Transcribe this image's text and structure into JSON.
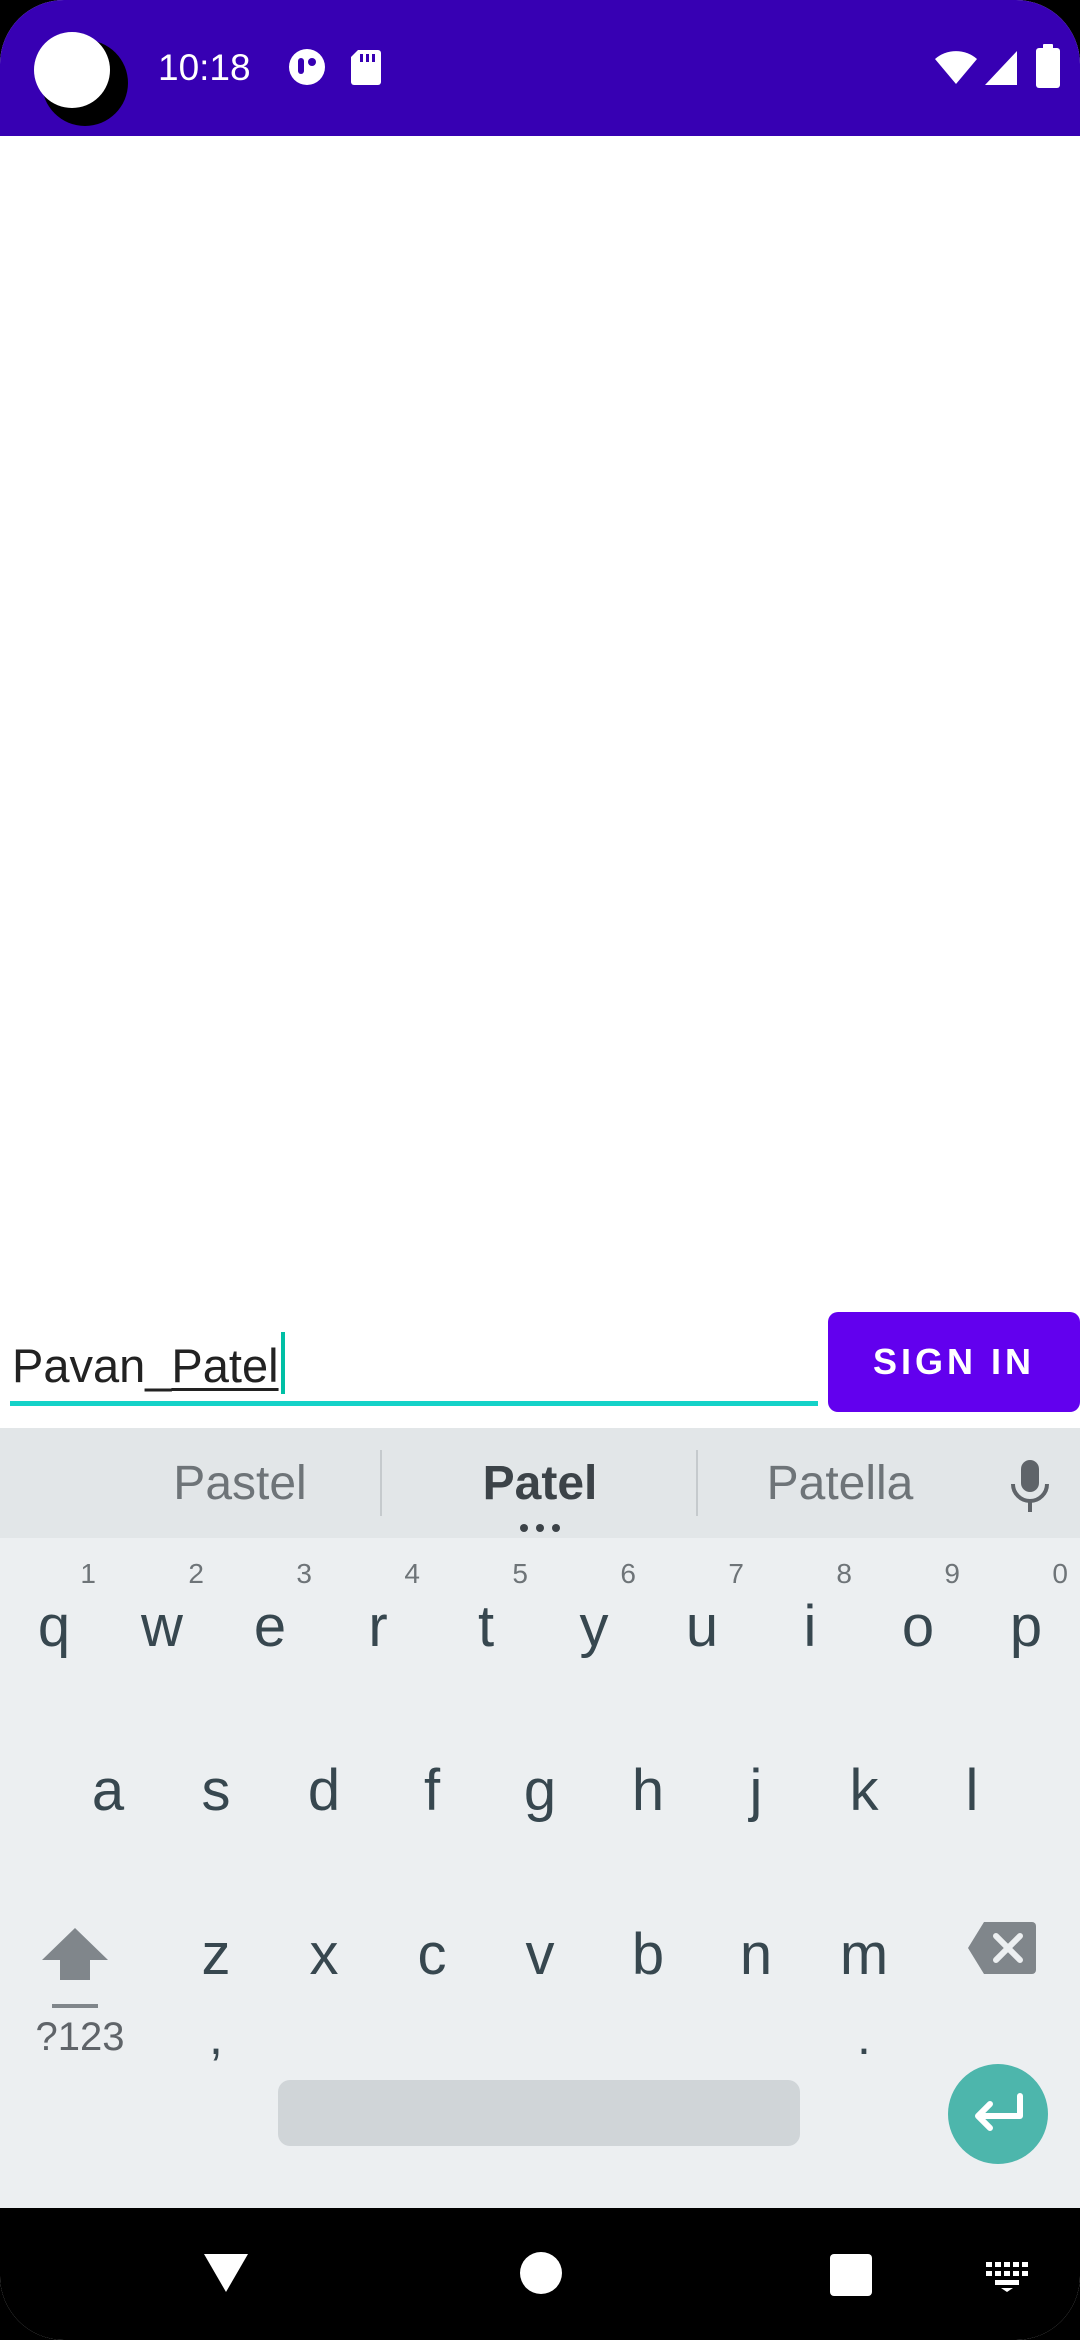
{
  "status_bar": {
    "time": "10:18",
    "icons": [
      "privacy-indicator-icon",
      "sd-card-icon",
      "wifi-icon",
      "signal-icon",
      "battery-icon"
    ],
    "background_color": "#3700b3"
  },
  "login": {
    "username_prefix": "Pavan_",
    "username_composing": "Patel",
    "sign_in_label": "SIGN IN",
    "accent_color": "#6200ee",
    "field_underline_color": "#14d2c8"
  },
  "keyboard": {
    "suggestions": [
      "Pastel",
      "Patel",
      "Patella"
    ],
    "row1": [
      {
        "key": "q",
        "hint": "1"
      },
      {
        "key": "w",
        "hint": "2"
      },
      {
        "key": "e",
        "hint": "3"
      },
      {
        "key": "r",
        "hint": "4"
      },
      {
        "key": "t",
        "hint": "5"
      },
      {
        "key": "y",
        "hint": "6"
      },
      {
        "key": "u",
        "hint": "7"
      },
      {
        "key": "i",
        "hint": "8"
      },
      {
        "key": "o",
        "hint": "9"
      },
      {
        "key": "p",
        "hint": "0"
      }
    ],
    "row2": [
      "a",
      "s",
      "d",
      "f",
      "g",
      "h",
      "j",
      "k",
      "l"
    ],
    "row3": [
      "z",
      "x",
      "c",
      "v",
      "b",
      "n",
      "m"
    ],
    "symbols_label": "?123",
    "comma": ",",
    "period": "."
  }
}
